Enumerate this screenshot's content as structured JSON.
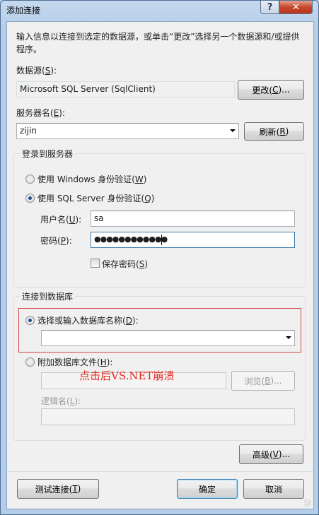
{
  "window": {
    "title": "添加连接",
    "help_glyph": "?",
    "close_glyph": "✕"
  },
  "intro": "输入信息以连接到选定的数据源，或单击“更改”选择另一个数据源和/或提供程序。",
  "datasource": {
    "label": "数据源(",
    "label_key": "S",
    "label_end": "):",
    "value": "Microsoft SQL Server (SqlClient)",
    "change_button": {
      "pre": "更改(",
      "key": "C",
      "post": ")..."
    }
  },
  "server": {
    "label": "服务器名(",
    "label_key": "E",
    "label_end": "):",
    "value": "zijin",
    "refresh_button": {
      "pre": "刷新(",
      "key": "R",
      "post": ")"
    }
  },
  "login_group": {
    "title": "登录到服务器",
    "windows_auth": {
      "pre": "使用 Windows 身份验证(",
      "key": "W",
      "post": ")",
      "checked": false
    },
    "sql_auth": {
      "pre": "使用 SQL Server 身份验证(",
      "key": "Q",
      "post": ")",
      "checked": true
    },
    "username": {
      "pre": "用户名(",
      "key": "U",
      "post": "):",
      "value": "sa"
    },
    "password": {
      "pre": "密码(",
      "key": "P",
      "post": "):",
      "value": "●●●●●●●●●●●●"
    },
    "save_password": {
      "pre": "保存密码(",
      "key": "S",
      "post": ")",
      "checked": false
    }
  },
  "db_group": {
    "title": "连接到数据库",
    "select_db": {
      "pre": "选择或输入数据库名称(",
      "key": "D",
      "post": "):",
      "checked": true,
      "value": ""
    },
    "attach_file": {
      "pre": "附加数据库文件(",
      "key": "H",
      "post": "):",
      "checked": false,
      "value": ""
    },
    "browse_button": {
      "pre": "浏览(",
      "key": "B",
      "post": ")..."
    },
    "logical_name": {
      "pre": "逻辑名(",
      "key": "L",
      "post": "):",
      "value": ""
    }
  },
  "annotation": {
    "text": "点击后VS.NET崩溃",
    "color": "#e0281d"
  },
  "advanced_button": {
    "pre": "高级(",
    "key": "V",
    "post": ")..."
  },
  "footer": {
    "test_button": {
      "pre": "测试连接(",
      "key": "T",
      "post": ")"
    },
    "ok_button": "确定",
    "cancel_button": "取消"
  }
}
